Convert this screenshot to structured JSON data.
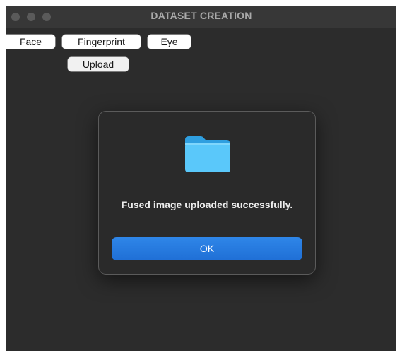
{
  "window": {
    "title": "DATASET CREATION"
  },
  "toolbar": {
    "face_label": "Face",
    "fingerprint_label": "Fingerprint",
    "eye_label": "Eye",
    "upload_label": "Upload"
  },
  "dialog": {
    "icon": "folder-icon",
    "message": "Fused image uploaded successfully.",
    "ok_label": "OK"
  },
  "colors": {
    "window_bg": "#2c2c2c",
    "titlebar_bg": "#373737",
    "dialog_bg": "#2a2a2a",
    "ok_button": "#1f6fd6",
    "folder": "#5ac8fa"
  }
}
